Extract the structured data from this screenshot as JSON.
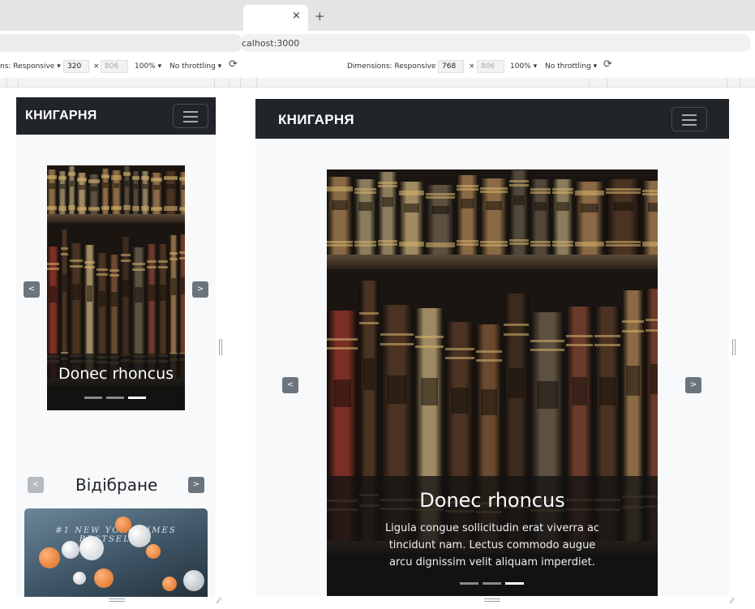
{
  "browser": {
    "tab_close": "×",
    "tab_new": "+",
    "address": "calhost:3000"
  },
  "devtools_left": {
    "dimensions_label": "ns: Responsive ▾",
    "width": "320",
    "times": "×",
    "height": "806",
    "zoom": "100% ▾",
    "throttling": "No throttling ▾"
  },
  "devtools_right": {
    "dimensions_label": "Dimensions: Responsive ▾",
    "width": "768",
    "times": "×",
    "height": "806",
    "zoom": "100% ▾",
    "throttling": "No throttling ▾"
  },
  "site": {
    "brand": "КНИГАРНЯ",
    "slide_title": "Donec rhoncus",
    "slide_text": "Ligula congue sollicitudin erat viverra ac tincidunt nam. Lectus commodo augue arcu dignissim velit aliquam imperdiet.",
    "prev": "<",
    "next": ">",
    "featured_title": "Відібране",
    "featured_card_text": "#1 NEW YORK TIMES BESTSELLER"
  },
  "carousel": {
    "slides": 3,
    "active_index": 2
  },
  "colors": {
    "navbar": "#212529",
    "page_bg": "#f8f9fb",
    "arrow": "#6c757d",
    "overlay": "#121212"
  },
  "icons": [
    "close-icon",
    "plus-icon",
    "rotate-icon",
    "hamburger-icon",
    "chevron-left-icon",
    "chevron-right-icon",
    "resize-handle-icon"
  ]
}
